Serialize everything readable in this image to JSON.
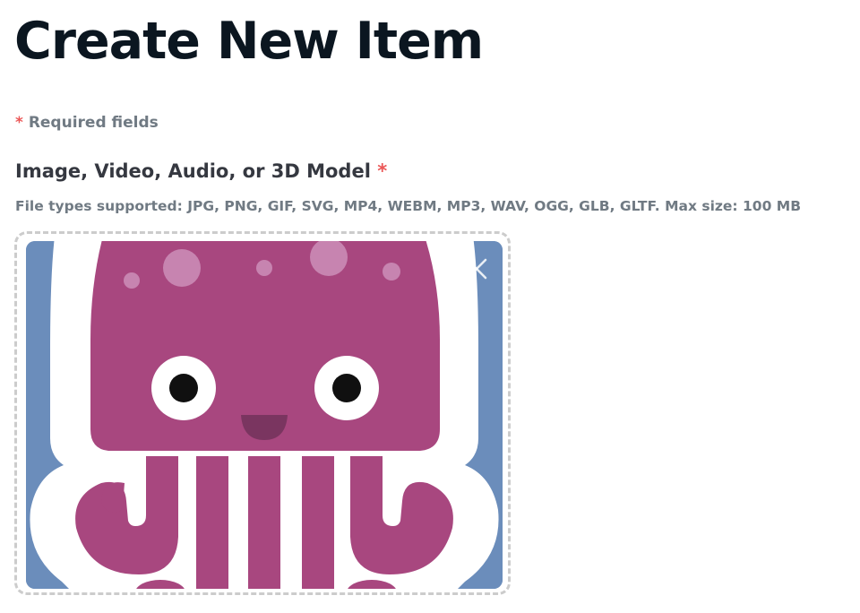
{
  "page": {
    "title": "Create New Item"
  },
  "form": {
    "required_asterisk": "*",
    "required_note": "Required fields",
    "media_field": {
      "label": "Image, Video, Audio, or 3D Model",
      "required_asterisk": "*",
      "hint": "File types supported: JPG, PNG, GIF, SVG, MP4, WEBM, MP3, WAV, OGG, GLB, GLTF. Max size: 100 MB",
      "preview_icon": "octopus-image",
      "remove_icon": "close-icon"
    }
  },
  "colors": {
    "asterisk": "#eb5757",
    "preview_background": "#6b8dbb",
    "octopus_body": "#a8477f",
    "octopus_outline": "#ffffff"
  }
}
